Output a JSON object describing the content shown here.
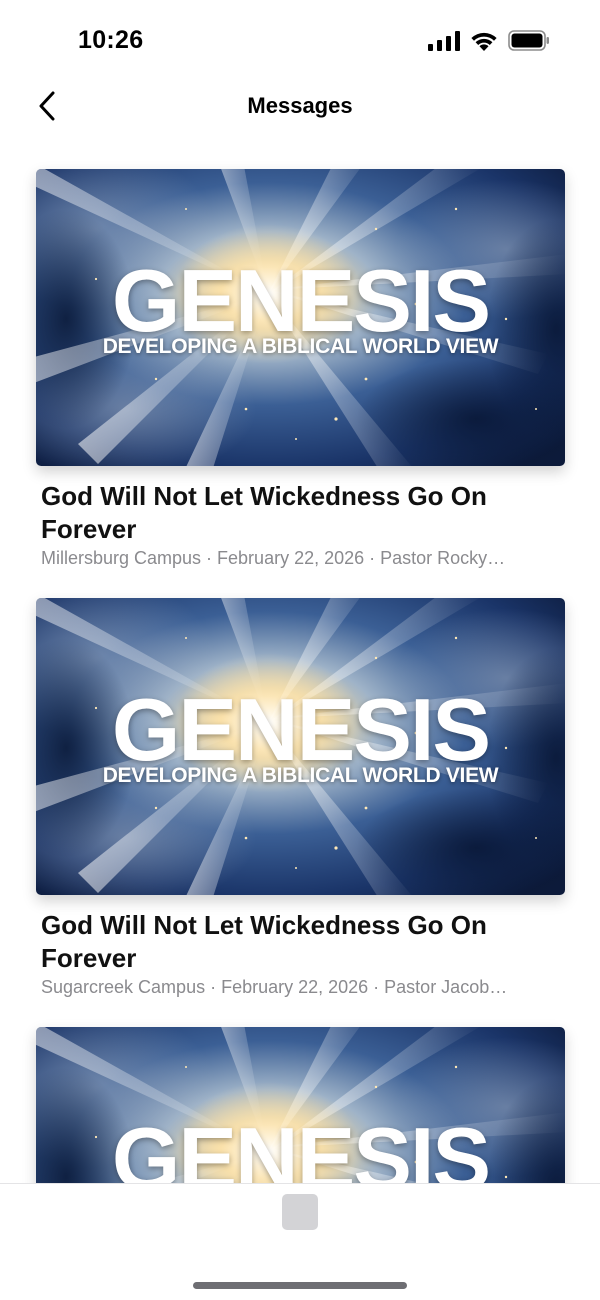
{
  "status": {
    "time": "10:26",
    "icons": [
      "cellular-signal-icon",
      "wifi-icon",
      "battery-icon"
    ]
  },
  "nav": {
    "title": "Messages",
    "back_icon": "chevron-left-icon"
  },
  "artwork": {
    "title": "GENESIS",
    "subtitle": "DEVELOPING A BIBLICAL WORLD VIEW"
  },
  "messages": [
    {
      "title": "God Will Not Let Wickedness Go On Forever",
      "meta": "Millersburg Campus · February 22, 2026 · Pastor Rocky…"
    },
    {
      "title": "God Will Not Let Wickedness Go On Forever",
      "meta": "Sugarcreek Campus · February 22, 2026 · Pastor Jacob…"
    },
    {
      "title": "",
      "meta": ""
    }
  ],
  "colors": {
    "background": "#ffffff",
    "meta_text": "#8a8a8e",
    "artwork_deep_blue": "#0f2247",
    "artwork_glow": "#f3d9a0"
  }
}
